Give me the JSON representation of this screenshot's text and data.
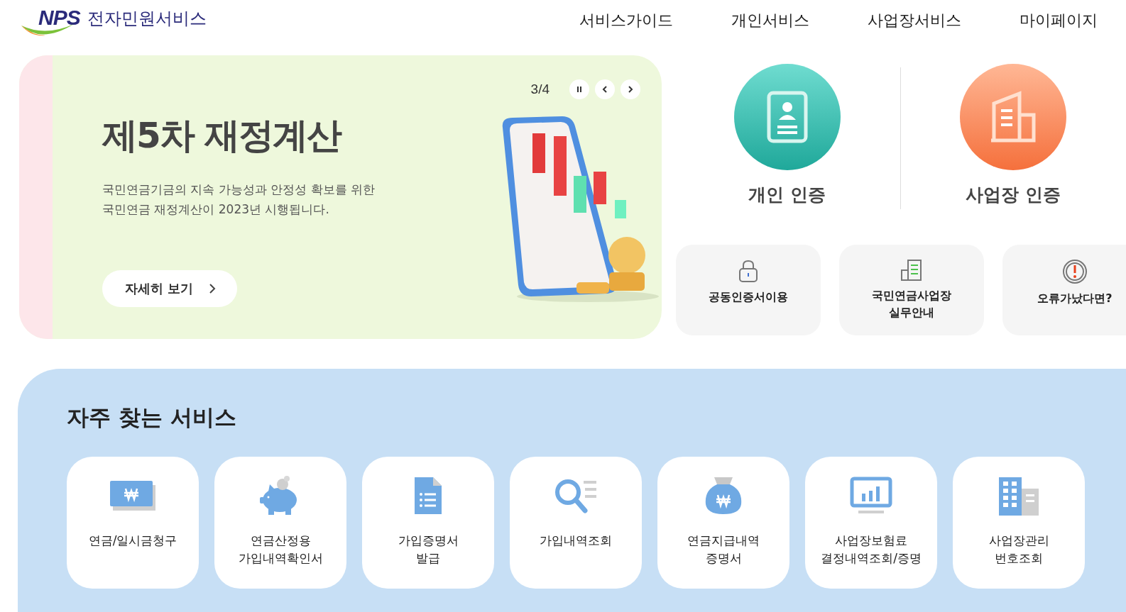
{
  "header": {
    "logo_mark": "NPS",
    "logo_text": "전자민원서비스",
    "nav": [
      {
        "label": "서비스가이드"
      },
      {
        "label": "개인서비스"
      },
      {
        "label": "사업장서비스"
      },
      {
        "label": "마이페이지"
      }
    ]
  },
  "banner": {
    "counter": "3/4",
    "title": "제5차 재정계산",
    "description_lines": [
      "국민연금기금의 지속 가능성과 안정성 확보를 위한",
      "국민연금 재정계산이 2023년 시행됩니다."
    ],
    "button": "자세히 보기",
    "kind": "picture"
  },
  "auth": [
    {
      "kind": "person",
      "label": "개인 인증"
    },
    {
      "kind": "business",
      "label": "사업장 인증"
    }
  ],
  "quick_links": [
    {
      "kind": "lock",
      "label": "공동인증서이용"
    },
    {
      "kind": "building",
      "label": "국민연금사업장\n실무안내"
    },
    {
      "kind": "alert",
      "label": "오류가났다면?"
    }
  ],
  "services": {
    "title": "자주 찾는 서비스",
    "items": [
      {
        "kind": "won-bill",
        "label": "연금/일시금청구"
      },
      {
        "kind": "piggy",
        "label": "연금산정용\n가입내역확인서"
      },
      {
        "kind": "document",
        "label": "가입증명서\n발급"
      },
      {
        "kind": "search-list",
        "label": "가입내역조회"
      },
      {
        "kind": "money-bag",
        "label": "연금지급내역\n증명서"
      },
      {
        "kind": "monitor-chart",
        "label": "사업장보험료\n결정내역조회/증명"
      },
      {
        "kind": "buildings",
        "label": "사업장관리\n번호조회"
      }
    ]
  }
}
